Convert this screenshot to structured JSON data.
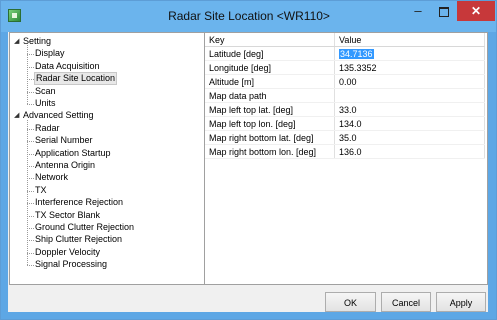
{
  "window": {
    "title": "Radar Site Location <WR110>",
    "controls": {
      "minimize": "–",
      "close": "✕"
    },
    "colors": {
      "frame": "#6bb4ed",
      "close": "#c7383a",
      "selection": "#3399ff"
    }
  },
  "tree": {
    "setting": {
      "label": "Setting",
      "children": [
        "Display",
        "Data Acquisition",
        "Radar Site Location",
        "Scan",
        "Units"
      ],
      "selected": "Radar Site Location"
    },
    "advanced": {
      "label": "Advanced Setting",
      "children": [
        "Radar",
        "Serial Number",
        "Application Startup",
        "Antenna Origin",
        "Network",
        "TX",
        "Interference Rejection",
        "TX Sector Blank",
        "Ground Clutter Rejection",
        "Ship Clutter Rejection",
        "Doppler Velocity",
        "Signal Processing"
      ]
    }
  },
  "table": {
    "headers": [
      "Key",
      "Value"
    ],
    "rows": [
      {
        "key": "Latitude [deg]",
        "value": "34.7136"
      },
      {
        "key": "Longitude [deg]",
        "value": "135.3352"
      },
      {
        "key": "Altitude [m]",
        "value": "0.00"
      },
      {
        "key": "Map data path",
        "value": ""
      },
      {
        "key": "Map left top lat. [deg]",
        "value": "33.0"
      },
      {
        "key": "Map left top lon. [deg]",
        "value": "134.0"
      },
      {
        "key": "Map right bottom lat. [deg]",
        "value": "35.0"
      },
      {
        "key": "Map right bottom lon. [deg]",
        "value": "136.0"
      }
    ]
  },
  "buttons": {
    "ok": "OK",
    "cancel": "Cancel",
    "apply": "Apply"
  }
}
